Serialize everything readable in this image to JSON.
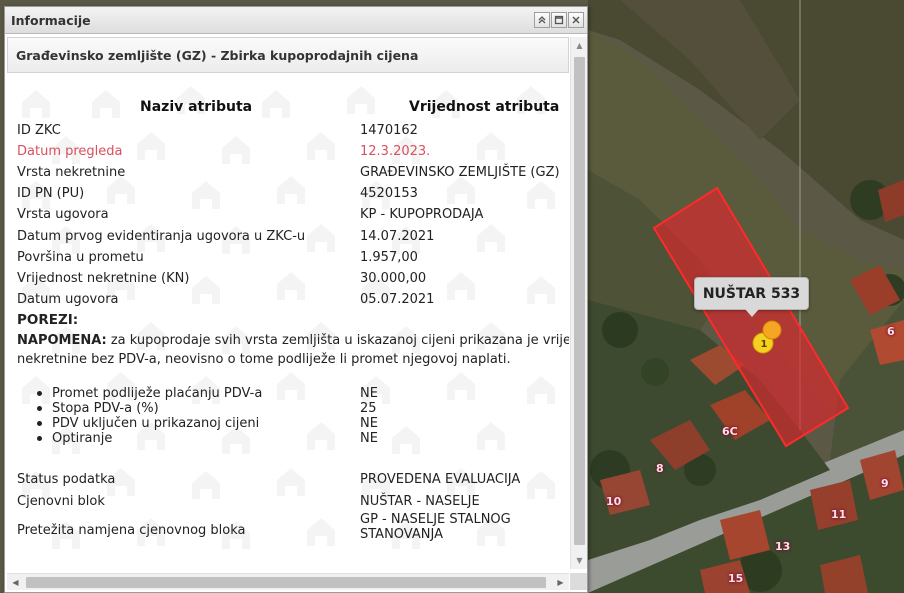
{
  "window": {
    "title": "Informacije",
    "panel_title": "Građevinsko zemljište (GZ) - Zbirka kupoprodajnih cijena"
  },
  "table": {
    "col_attr": "Naziv atributa",
    "col_value": "Vrijednost atributa",
    "rows": [
      {
        "label": "ID ZKC",
        "value": "1470162"
      },
      {
        "label": "Datum pregleda",
        "value": "12.3.2023."
      },
      {
        "label": "Vrsta nekretnine",
        "value": "GRAĐEVINSKO ZEMLJIŠTE (GZ)"
      },
      {
        "label": "ID PN (PU)",
        "value": "4520153"
      },
      {
        "label": "Vrsta ugovora",
        "value": "KP - KUPOPRODAJA"
      },
      {
        "label": "Datum prvog evidentiranja ugovora u ZKC-u",
        "value": "14.07.2021"
      },
      {
        "label": "Površina u prometu",
        "value": "1.957,00"
      },
      {
        "label": "Vrijednost nekretnine (KN)",
        "value": "30.000,00"
      },
      {
        "label": "Datum ugovora",
        "value": "05.07.2021"
      }
    ]
  },
  "taxes": {
    "heading": "POREZI:",
    "note_bold": "NAPOMENA:",
    "note_line1": " za kupoprodaje svih vrsta zemljišta u iskazanoj cijeni prikazana je vrijednost",
    "note_line2": "nekretnine bez PDV-a, neovisno o tome podliježe li promet njegovoj naplati.",
    "items": [
      {
        "label": "Promet podliježe plaćanju PDV-a",
        "value": "NE"
      },
      {
        "label": "Stopa PDV-a (%)",
        "value": "25"
      },
      {
        "label": "PDV uključen u prikazanoj cijeni",
        "value": "NE"
      },
      {
        "label": "Optiranje",
        "value": "NE"
      }
    ]
  },
  "status": {
    "rows": [
      {
        "label": "Status podatka",
        "value": "PROVEDENA EVALUACIJA"
      },
      {
        "label": "Cjenovni blok",
        "value": "NUŠTAR - NASELJE"
      }
    ],
    "purpose_label": "Pretežita namjena cjenovnog bloka",
    "purpose_value_1": "GP - NASELJE STALNOG",
    "purpose_value_2": "STANOVANJA"
  },
  "map": {
    "parcel_label": "NUŠTAR 533",
    "marker_number": "1",
    "house_numbers": [
      "6",
      "6C",
      "8",
      "10",
      "9",
      "11",
      "13",
      "15"
    ],
    "parcel_color": "#e0262e"
  },
  "icons": {
    "collapse": "double-chevron-up-icon",
    "maximize": "maximize-icon",
    "close": "close-icon"
  }
}
